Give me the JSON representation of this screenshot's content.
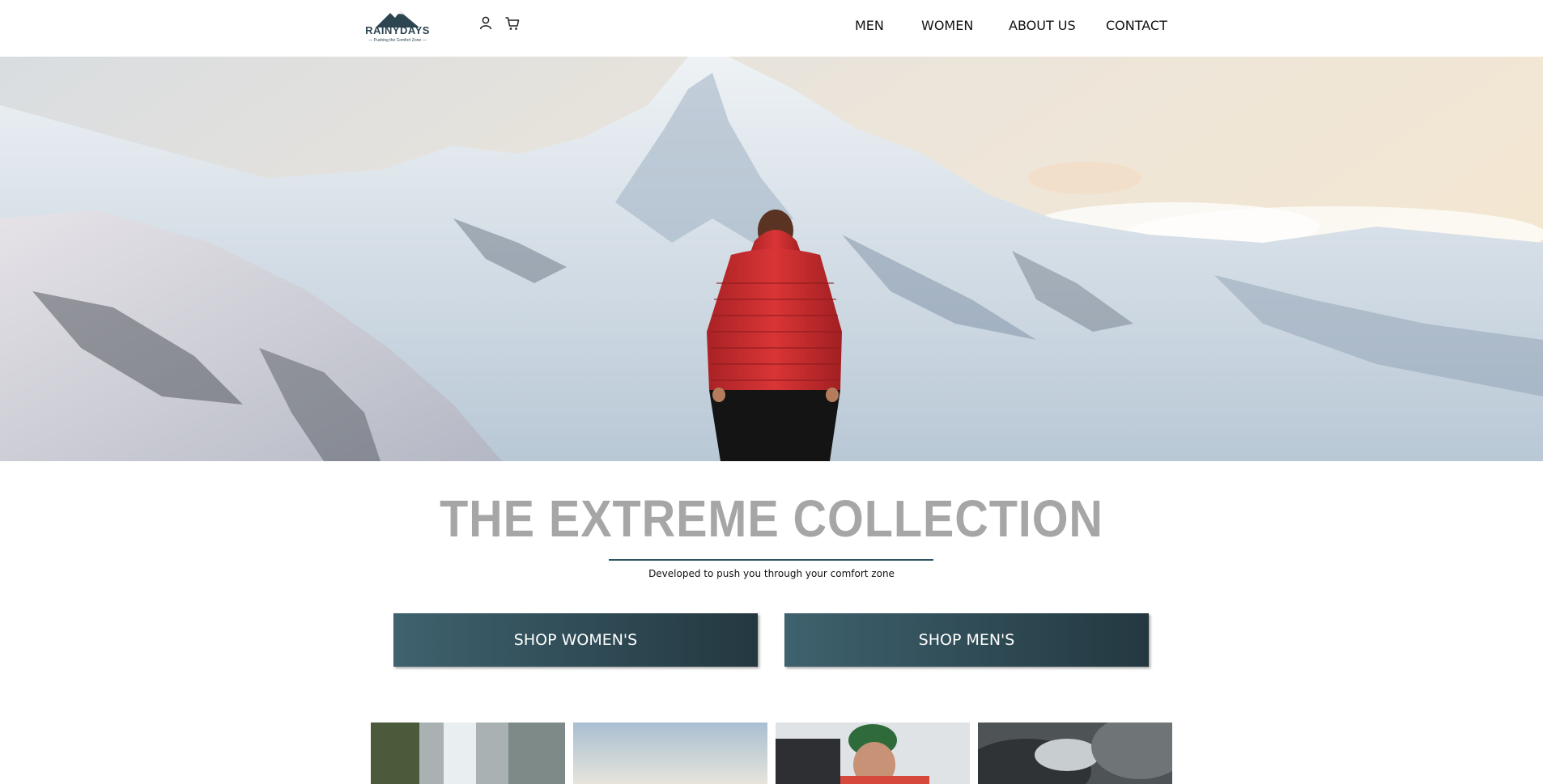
{
  "header": {
    "logo": {
      "wordmark": "RAINYDAYS",
      "tagline": "— Pushing the Comfort Zone —"
    },
    "icons": [
      "user-icon",
      "cart-icon"
    ],
    "nav": [
      "MEN",
      "WOMEN",
      "ABOUT US",
      "CONTACT"
    ]
  },
  "hero": {
    "image": "man-in-red-jacket-snowy-mountain"
  },
  "collection": {
    "title": "THE EXTREME COLLECTION",
    "subtitle": "Developed to push you through your comfort zone",
    "buttons": {
      "women": "SHOP WOMEN'S",
      "men": "SHOP MEN'S"
    }
  },
  "gallery": [
    "waterfall",
    "sky",
    "hiker-green-hat",
    "rocky-waves"
  ],
  "colors": {
    "accent": "#2b5561",
    "button": "#345560",
    "title": "#a6a6a6"
  }
}
